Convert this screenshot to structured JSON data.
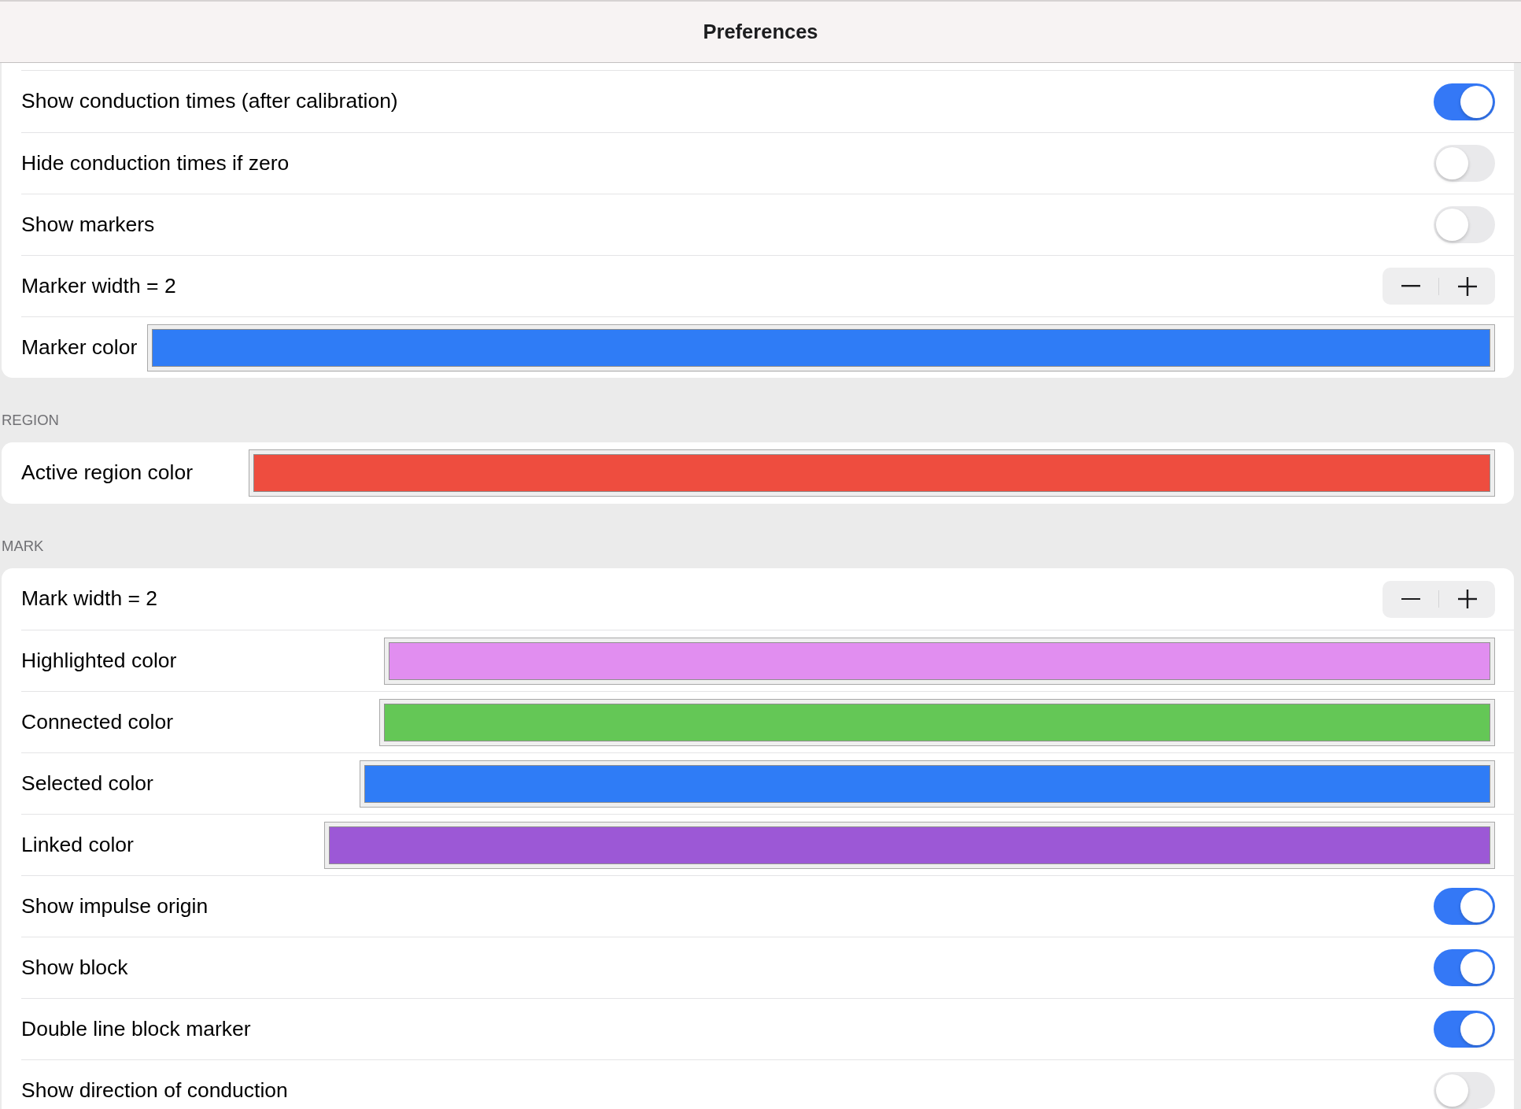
{
  "title": "Preferences",
  "sections": [
    {
      "rows": [
        {
          "kind": "toggle",
          "label": "Show conduction times (after calibration)",
          "on": true
        },
        {
          "kind": "toggle",
          "label": "Hide conduction times if zero",
          "on": false
        },
        {
          "kind": "toggle",
          "label": "Show markers",
          "on": false
        },
        {
          "kind": "stepper",
          "label": "Marker width = 2"
        },
        {
          "kind": "color",
          "label": "Marker color",
          "color": "#2f7cf6"
        }
      ]
    },
    {
      "header": "REGION",
      "rows": [
        {
          "kind": "color",
          "label": "Active region color",
          "color": "#ee4d3f"
        }
      ]
    },
    {
      "header": "MARK",
      "rows": [
        {
          "kind": "stepper",
          "label": "Mark width = 2"
        },
        {
          "kind": "color",
          "label": "Highlighted color",
          "color": "#e18ef0"
        },
        {
          "kind": "color",
          "label": "Connected color",
          "color": "#64c756"
        },
        {
          "kind": "color",
          "label": "Selected color",
          "color": "#2f7cf6"
        },
        {
          "kind": "color",
          "label": "Linked color",
          "color": "#9c58d6"
        },
        {
          "kind": "toggle",
          "label": "Show impulse origin",
          "on": true
        },
        {
          "kind": "toggle",
          "label": "Show block",
          "on": true
        },
        {
          "kind": "toggle",
          "label": "Double line block marker",
          "on": true
        },
        {
          "kind": "toggle",
          "label": "Show direction of conduction",
          "on": false
        }
      ]
    }
  ]
}
